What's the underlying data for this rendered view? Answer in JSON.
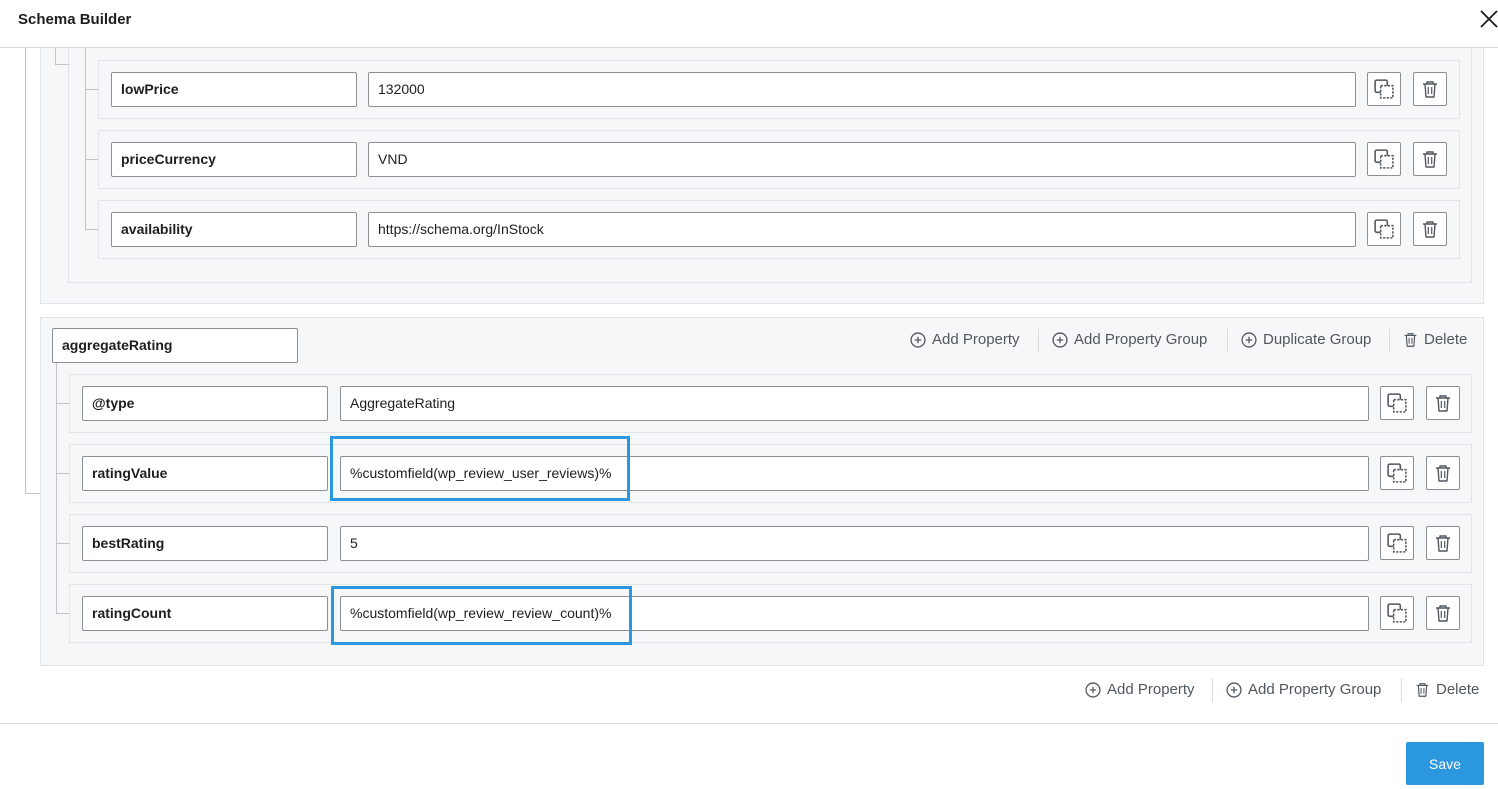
{
  "window": {
    "title": "Schema Builder"
  },
  "offers_rows": [
    {
      "key": "lowPrice",
      "value": "132000"
    },
    {
      "key": "priceCurrency",
      "value": "VND"
    },
    {
      "key": "availability",
      "value": "https://schema.org/InStock"
    }
  ],
  "aggregate_group": {
    "name": "aggregateRating",
    "actions": {
      "add_property": "Add Property",
      "add_property_group": "Add Property Group",
      "duplicate_group": "Duplicate Group",
      "delete": "Delete"
    },
    "rows": [
      {
        "key": "@type",
        "value": "AggregateRating"
      },
      {
        "key": "ratingValue",
        "value": "%customfield(wp_review_user_reviews)%"
      },
      {
        "key": "bestRating",
        "value": "5"
      },
      {
        "key": "ratingCount",
        "value": "%customfield(wp_review_review_count)%"
      }
    ]
  },
  "bottom_actions": {
    "add_property": "Add Property",
    "add_property_group": "Add Property Group",
    "delete": "Delete"
  },
  "footer": {
    "save_label": "Save"
  },
  "colors": {
    "accent": "#2b97df",
    "highlight": "#2b97df"
  },
  "icons": [
    "close-icon",
    "duplicate-icon",
    "trash-icon",
    "plus-circle-icon"
  ]
}
